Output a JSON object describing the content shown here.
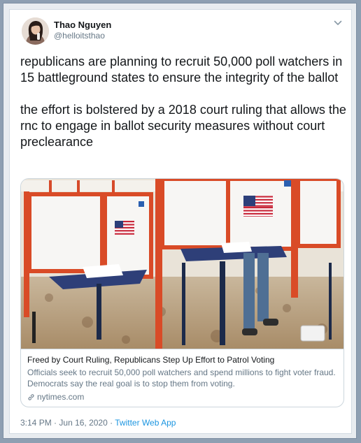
{
  "author": {
    "display_name": "Thao Nguyen",
    "handle": "@helloitsthao",
    "avatar_icon": "profile-photo"
  },
  "tweet": {
    "paragraphs": [
      "republicans are planning to recruit 50,000 poll watchers in 15 battleground states to ensure the integrity of the ballot",
      "the effort is bolstered by a 2018 court ruling that allows the rnc to engage in ballot security measures without court preclearance"
    ]
  },
  "link_card": {
    "title": "Freed by Court Ruling, Republicans Step Up Effort to Patrol Voting",
    "description": "Officials seek to recruit 50,000 poll watchers and spend millions to fight voter fraud. Democrats say the real goal is to stop them from voting.",
    "domain": "nytimes.com",
    "image_subject": "voting-booths-with-american-flags"
  },
  "meta": {
    "time": "3:14 PM",
    "separator": "·",
    "date": "Jun 16, 2020",
    "source": "Twitter Web App"
  },
  "colors": {
    "text": "#14171a",
    "secondary": "#657786",
    "link": "#1b95e0",
    "border": "#ccd6dd"
  }
}
